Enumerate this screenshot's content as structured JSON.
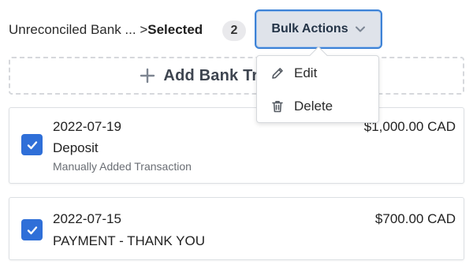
{
  "header": {
    "breadcrumb_parent": "Unreconciled Bank ...",
    "breadcrumb_separator": " >",
    "breadcrumb_current": "Selected",
    "selected_count": "2",
    "bulk_actions_label": "Bulk Actions"
  },
  "add_bank_button": {
    "label": "Add Bank Transaction",
    "icon": "plus-icon"
  },
  "bulk_menu": {
    "items": [
      {
        "label": "Edit",
        "icon": "pencil-icon"
      },
      {
        "label": "Delete",
        "icon": "trash-icon"
      }
    ]
  },
  "transactions": [
    {
      "date": "2022-07-19",
      "description": "Deposit",
      "note": "Manually Added Transaction",
      "amount": "$1,000.00 CAD",
      "checked": true
    },
    {
      "date": "2022-07-15",
      "description": "PAYMENT - THANK YOU",
      "note": "",
      "amount": "$700.00 CAD",
      "checked": true
    }
  ],
  "colors": {
    "accent": "#2f6fd8",
    "button_border": "#3d82d6",
    "button_bg": "#dfe3ea"
  }
}
